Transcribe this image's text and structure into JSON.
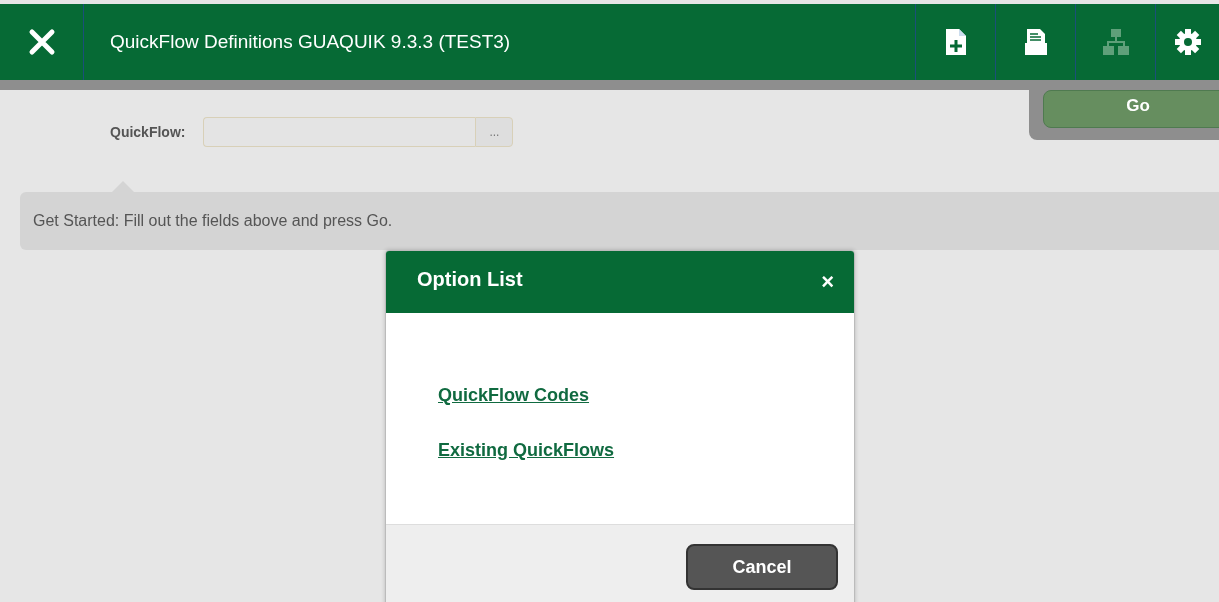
{
  "header": {
    "title": "QuickFlow Definitions GUAQUIK 9.3.3 (TEST3)",
    "tools": [
      {
        "kind": "add-document",
        "disabled": false
      },
      {
        "kind": "document",
        "disabled": false
      },
      {
        "kind": "hierarchy",
        "disabled": true
      },
      {
        "kind": "settings",
        "disabled": false
      }
    ]
  },
  "go_button": {
    "label": "Go"
  },
  "quickflow": {
    "label": "QuickFlow:",
    "lookup": "..."
  },
  "info": {
    "text": "Get Started: Fill out the fields above and press Go."
  },
  "dialog": {
    "title": "Option List",
    "close": "×",
    "links": [
      "QuickFlow Codes",
      "Existing QuickFlows"
    ],
    "cancel": "Cancel"
  }
}
